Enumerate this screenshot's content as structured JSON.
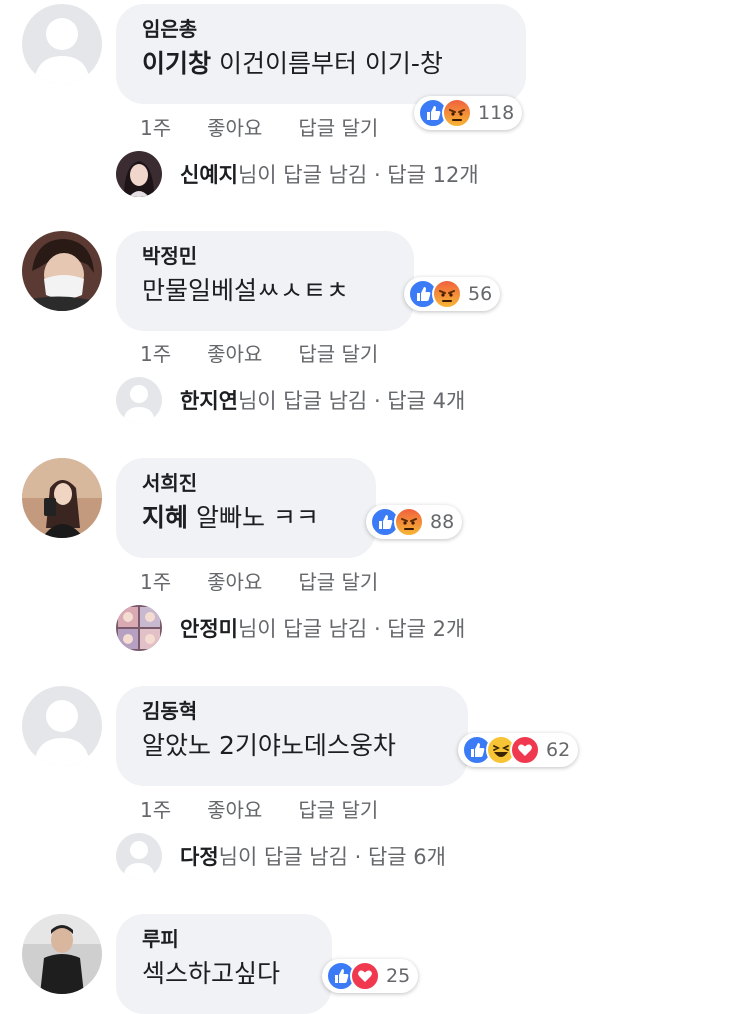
{
  "comments": [
    {
      "author": "임은총",
      "text_bold": "이기창",
      "text": "이건이름부터 이기-창",
      "reaction_count": "118",
      "time": "1주",
      "like": "좋아요",
      "reply_action": "답글 달기",
      "reply_name": "신예지",
      "reply_suffix": "님이 답글 남김",
      "reply_count": "· 답글 12개"
    },
    {
      "author": "박정민",
      "text_bold": "",
      "text": "만물일베설ㅆㅅㅌㅊ",
      "reaction_count": "56",
      "time": "1주",
      "like": "좋아요",
      "reply_action": "답글 달기",
      "reply_name": "한지연",
      "reply_suffix": "님이 답글 남김",
      "reply_count": "· 답글 4개"
    },
    {
      "author": "서희진",
      "text_bold": "지혜",
      "text": "알빠노 ㅋㅋ",
      "reaction_count": "88",
      "time": "1주",
      "like": "좋아요",
      "reply_action": "답글 달기",
      "reply_name": "안정미",
      "reply_suffix": "님이 답글 남김",
      "reply_count": "· 답글 2개"
    },
    {
      "author": "김동혁",
      "text_bold": "",
      "text": "알았노 2기야노데스웅차",
      "reaction_count": "62",
      "time": "1주",
      "like": "좋아요",
      "reply_action": "답글 달기",
      "reply_name": "다정",
      "reply_suffix": "님이 답글 남김",
      "reply_count": "· 답글 6개"
    },
    {
      "author": "루피",
      "text_bold": "",
      "text": "섹스하고싶다",
      "reaction_count": "25"
    }
  ],
  "reaction_icons": {
    "c0": [
      "like-icon",
      "angry-icon"
    ],
    "c1": [
      "like-icon",
      "angry-icon"
    ],
    "c2": [
      "like-icon",
      "angry-icon"
    ],
    "c3": [
      "like-icon",
      "haha-icon",
      "love-icon"
    ],
    "c4": [
      "like-icon",
      "love-icon"
    ]
  },
  "colors": {
    "bubble": "#f0f2f5",
    "like": "#3b7cf6",
    "love": "#f0394f",
    "secondary_text": "#65676b"
  }
}
